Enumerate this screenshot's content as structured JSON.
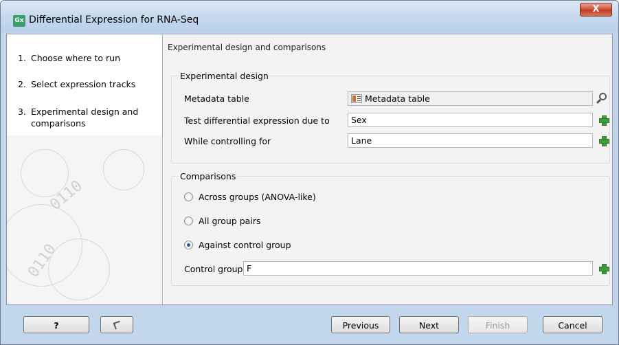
{
  "window": {
    "app_icon_text": "Gx",
    "title": "Differential Expression for RNA-Seq",
    "close_symbol": "X"
  },
  "sidebar": {
    "steps": [
      {
        "num": "1.",
        "label": "Choose where to run"
      },
      {
        "num": "2.",
        "label": "Select expression tracks"
      },
      {
        "num": "3.",
        "label": "Experimental design and comparisons"
      }
    ],
    "decor_text": [
      "0110",
      "0110"
    ]
  },
  "main": {
    "header": "Experimental design and comparisons",
    "experimental_design": {
      "title": "Experimental design",
      "metadata_label": "Metadata table",
      "metadata_value": "Metadata table",
      "test_label": "Test differential expression due to",
      "test_value": "Sex",
      "control_label": "While controlling for",
      "control_value": "Lane"
    },
    "comparisons": {
      "title": "Comparisons",
      "options": [
        {
          "label": "Across groups (ANOVA-like)",
          "checked": false
        },
        {
          "label": "All group pairs",
          "checked": false
        },
        {
          "label": "Against control group",
          "checked": true
        }
      ],
      "control_group_label": "Control group",
      "control_group_value": "F"
    }
  },
  "footer": {
    "help_label": "?",
    "previous_label": "Previous",
    "next_label": "Next",
    "finish_label": "Finish",
    "cancel_label": "Cancel"
  },
  "icons": {
    "app": "gx-app-icon",
    "close": "close-icon",
    "metadata": "metadata-table-icon",
    "browse": "browse-icon",
    "add": "plus-icon",
    "back": "back-icon"
  },
  "colors": {
    "accent_green": "#3f9c3f",
    "close_red": "#c03b1e",
    "frame_blue": "#c2d6ec"
  }
}
